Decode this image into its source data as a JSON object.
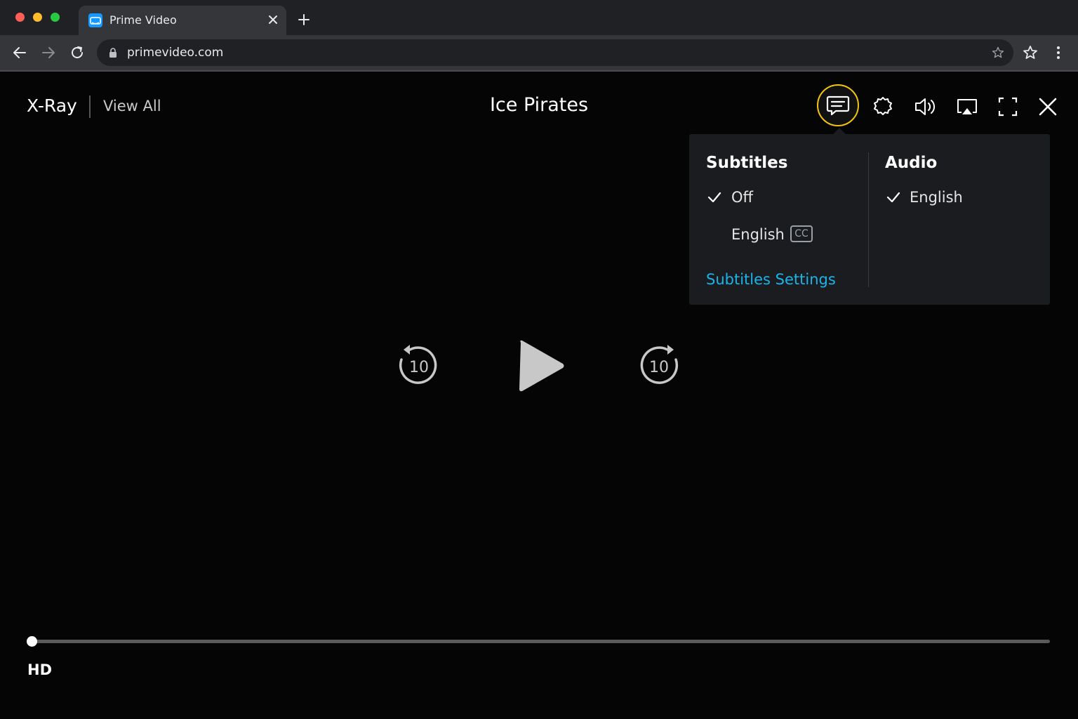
{
  "browser": {
    "tab": {
      "title": "Prime Video",
      "favicon": "prime-video-favicon"
    },
    "url": "primevideo.com",
    "icons": [
      "back-icon",
      "forward-icon",
      "reload-icon",
      "lock-icon",
      "bookmark-star-icon",
      "menu-icon",
      "close-icon",
      "plus-icon"
    ]
  },
  "player": {
    "xray_label": "X-Ray",
    "view_all_label": "View All",
    "title": "Ice Pirates",
    "top_controls": [
      "subtitles-icon",
      "settings-icon",
      "volume-icon",
      "airplay-icon",
      "fullscreen-icon",
      "close-icon"
    ],
    "panel": {
      "subtitles": {
        "heading": "Subtitles",
        "options": [
          {
            "label": "Off",
            "selected": true
          },
          {
            "label": "English",
            "selected": false,
            "badge": "CC"
          }
        ],
        "settings_link": "Subtitles Settings"
      },
      "audio": {
        "heading": "Audio",
        "options": [
          {
            "label": "English",
            "selected": true
          }
        ]
      }
    },
    "center_controls": {
      "rewind_seconds": "10",
      "forward_seconds": "10"
    },
    "progress_fraction": 0.005,
    "quality_badge": "HD",
    "colors": {
      "accent_link": "#1ab4ea",
      "focus_ring": "#f0c40f",
      "background": "#000000"
    }
  }
}
